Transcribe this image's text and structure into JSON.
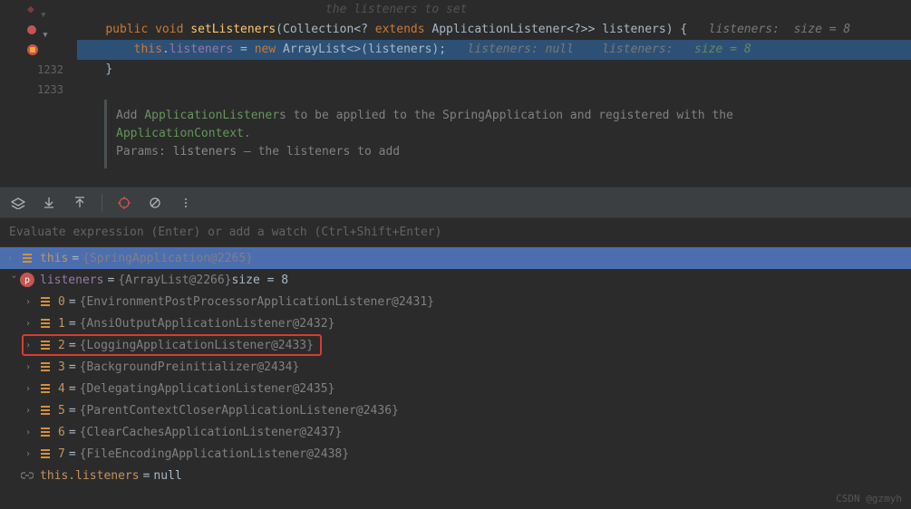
{
  "editor": {
    "line_partial": {
      "hint": "the listeners to set"
    },
    "line1": {
      "kw_public": "public",
      "kw_void": "void",
      "method": "setListeners",
      "param_type1": "Collection",
      "param_generic_open": "<?",
      "kw_extends": "extends",
      "param_type2": "ApplicationListener",
      "param_generic_close": "<?>>",
      "param_name": "listeners",
      "close": ") {",
      "hint_label": "listeners:",
      "hint_val": "size = 8"
    },
    "line2": {
      "kw_this": "this",
      "dot": ".",
      "field": "listeners",
      "eq": " = ",
      "kw_new": "new",
      "type": "ArrayList",
      "generic": "<>(",
      "param": "listeners",
      "close": ");",
      "hint1_label": "listeners:",
      "hint1_val": "null",
      "hint2_label": "listeners:",
      "hint2_val": "size = 8"
    },
    "line3": {
      "brace": "}"
    },
    "line_numbers": {
      "n1": "1232",
      "n2": "1233"
    }
  },
  "doc": {
    "line1_pre": "Add ",
    "line1_type": "ApplicationListener",
    "line1_post": "s to be applied to the SpringApplication and registered with the",
    "line2_type": "ApplicationContext",
    "line2_post": ".",
    "params_label": "Params:",
    "param_name": "listeners",
    "param_dash": " – ",
    "param_desc": "the listeners to add"
  },
  "expr_input": {
    "placeholder": "Evaluate expression (Enter) or add a watch (Ctrl+Shift+Enter)"
  },
  "vars": {
    "this_row": {
      "name": "this",
      "eq": " = ",
      "val": "{SpringApplication@2265}"
    },
    "listeners_row": {
      "name": "listeners",
      "eq": " = ",
      "val": "{ArrayList@2266}  ",
      "size": "size = 8"
    },
    "items": [
      {
        "idx": "0",
        "eq": " = ",
        "val": "{EnvironmentPostProcessorApplicationListener@2431}"
      },
      {
        "idx": "1",
        "eq": " = ",
        "val": "{AnsiOutputApplicationListener@2432}"
      },
      {
        "idx": "2",
        "eq": " = ",
        "val": "{LoggingApplicationListener@2433}"
      },
      {
        "idx": "3",
        "eq": " = ",
        "val": "{BackgroundPreinitializer@2434}"
      },
      {
        "idx": "4",
        "eq": " = ",
        "val": "{DelegatingApplicationListener@2435}"
      },
      {
        "idx": "5",
        "eq": " = ",
        "val": "{ParentContextCloserApplicationListener@2436}"
      },
      {
        "idx": "6",
        "eq": " = ",
        "val": "{ClearCachesApplicationListener@2437}"
      },
      {
        "idx": "7",
        "eq": " = ",
        "val": "{FileEncodingApplicationListener@2438}"
      }
    ],
    "this_listeners": {
      "name": "this.listeners",
      "eq": " = ",
      "val": "null"
    }
  },
  "watermark": "CSDN @gzmyh"
}
